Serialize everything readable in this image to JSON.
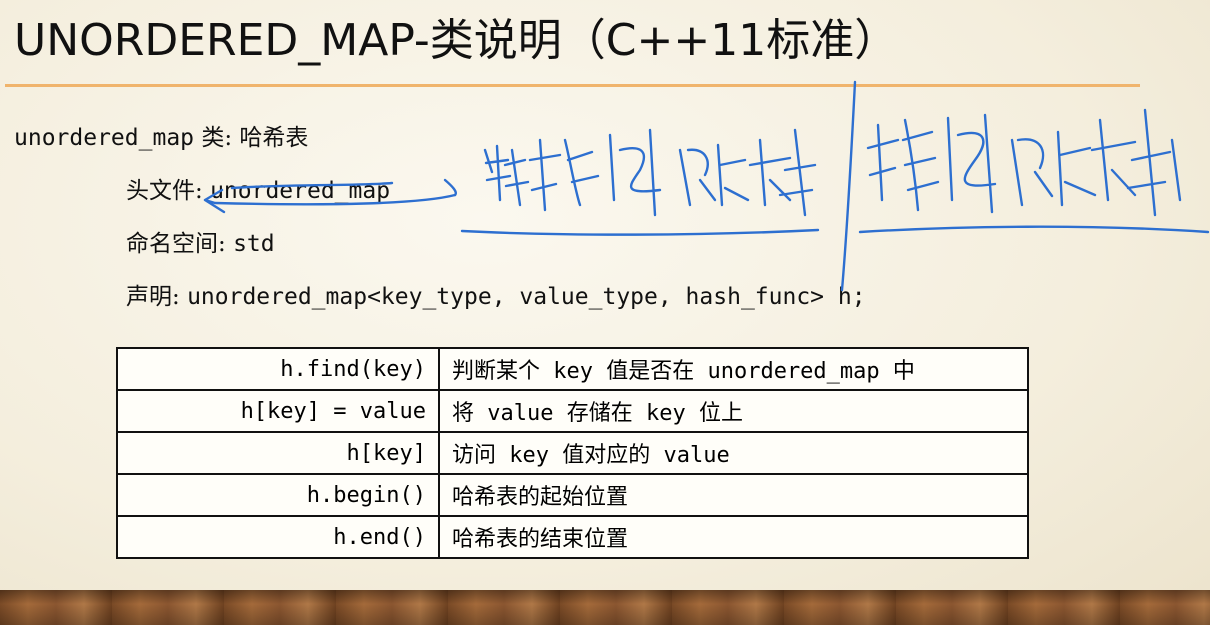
{
  "slide": {
    "title": "UNORDERED_MAP-类说明（C++11标准）",
    "intro": {
      "code": "unordered_map",
      "text": "类: 哈希表"
    },
    "header_file": {
      "label": "头文件:",
      "value": "unordered_map"
    },
    "namespace": {
      "label": "命名空间:",
      "value": "std"
    },
    "declaration": {
      "label": "声明:",
      "value": "unordered_map<key_type, value_type, hash_func> h;"
    },
    "api_table": [
      {
        "fn": "h.find(key)",
        "desc": "判断某个 key 值是否在 unordered_map 中"
      },
      {
        "fn": "h[key] = value",
        "desc": "将 value 存储在 key 位上"
      },
      {
        "fn": "h[key]",
        "desc": "访问 key 值对应的 value"
      },
      {
        "fn": "h.begin()",
        "desc": "哈希表的起始位置"
      },
      {
        "fn": "h.end()",
        "desc": "哈希表的结束位置"
      }
    ]
  },
  "annotations": {
    "left_note": "非排序映射",
    "right_note": "排序映射",
    "ink_color": "#2d6fd0"
  },
  "colors": {
    "title_rule": "#f0b46c",
    "background": "#f7f2e4"
  }
}
